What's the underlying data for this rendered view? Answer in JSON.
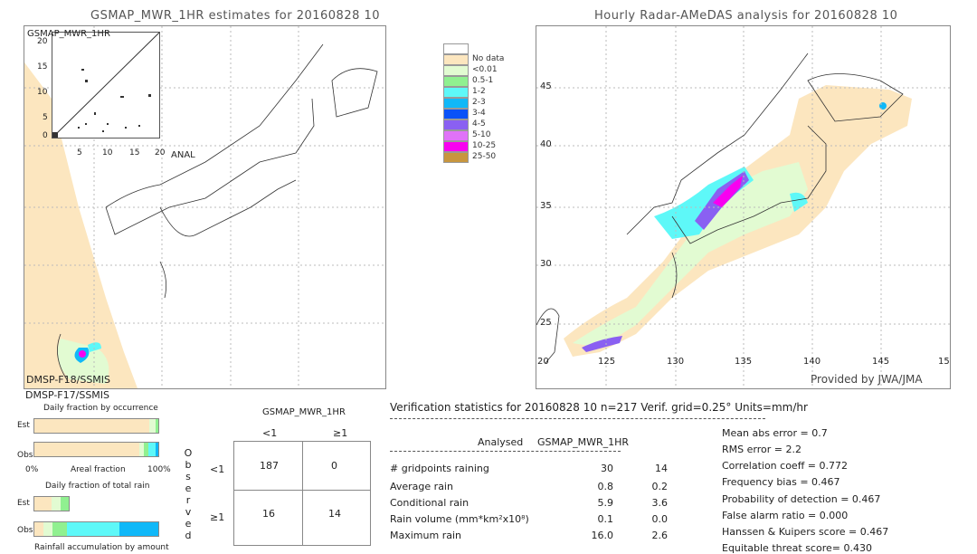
{
  "left_map": {
    "title": "GSMAP_MWR_1HR estimates for 20160828 10",
    "inset_label": "GSMAP_MWR_1HR",
    "inset_y_ticks": [
      "20",
      "15",
      "10",
      "5",
      "0"
    ],
    "inset_x_ticks": [
      "5",
      "10",
      "15",
      "20"
    ],
    "inset_x_label": "ANAL",
    "sensor_labels": [
      "DMSP-F18/SSMIS",
      "DMSP-F17/SSMIS"
    ]
  },
  "right_map": {
    "title": "Hourly Radar-AMeDAS analysis for 20160828 10",
    "lat_ticks": [
      "45",
      "40",
      "35",
      "30",
      "25",
      "20"
    ],
    "lon_ticks": [
      "125",
      "130",
      "135",
      "140",
      "145",
      "15"
    ],
    "credit": "Provided by JWA/JMA"
  },
  "legend": {
    "items": [
      {
        "label": "",
        "color": "#ffffff"
      },
      {
        "label": "No data",
        "color": "#fce6bf"
      },
      {
        "label": "<0.01",
        "color": "#e2fbd2"
      },
      {
        "label": "0.5-1",
        "color": "#90f090"
      },
      {
        "label": "1-2",
        "color": "#5ef8f8"
      },
      {
        "label": "2-3",
        "color": "#10b8f8"
      },
      {
        "label": "3-4",
        "color": "#0a52f8"
      },
      {
        "label": "4-5",
        "color": "#8a60f2"
      },
      {
        "label": "5-10",
        "color": "#e072f8"
      },
      {
        "label": "10-25",
        "color": "#f800f0"
      },
      {
        "label": "25-50",
        "color": "#c8963e"
      }
    ]
  },
  "fraction_charts": {
    "occurrence_title": "Daily fraction by occurrence",
    "est_label": "Est",
    "obs_label": "Obs",
    "axis_left": "0%",
    "axis_mid": "Areal fraction",
    "axis_right": "100%",
    "total_rain_title": "Daily fraction of total rain",
    "accumulation_title": "Rainfall accumulation by amount"
  },
  "contingency": {
    "title": "GSMAP_MWR_1HR",
    "col_headers": [
      "<1",
      "≥1"
    ],
    "row_headers": [
      "<1",
      "≥1"
    ],
    "side_label": [
      "O",
      "b",
      "s",
      "e",
      "r",
      "v",
      "e",
      "d"
    ],
    "cells": [
      [
        "187",
        "0"
      ],
      [
        "16",
        "14"
      ]
    ]
  },
  "stats": {
    "header": "Verification statistics for 20160828 10   n=217   Verif. grid=0.25°   Units=mm/hr",
    "col_analysed": "Analysed",
    "col_est": "GSMAP_MWR_1HR",
    "rows": [
      {
        "label": "# gridpoints raining",
        "a": "30",
        "b": "14"
      },
      {
        "label": "Average rain",
        "a": "0.8",
        "b": "0.2"
      },
      {
        "label": "Conditional rain",
        "a": "5.9",
        "b": "3.6"
      },
      {
        "label": "Rain volume (mm*km²x10⁸)",
        "a": "0.1",
        "b": "0.0"
      },
      {
        "label": "Maximum rain",
        "a": "16.0",
        "b": "2.6"
      }
    ],
    "scores": [
      "Mean abs error = 0.7",
      "RMS error = 2.2",
      "Correlation coeff = 0.772",
      "Frequency bias = 0.467",
      "Probability of detection = 0.467",
      "False alarm ratio = 0.000",
      "Hanssen & Kuipers score = 0.467",
      "Equitable threat score= 0.430"
    ]
  }
}
